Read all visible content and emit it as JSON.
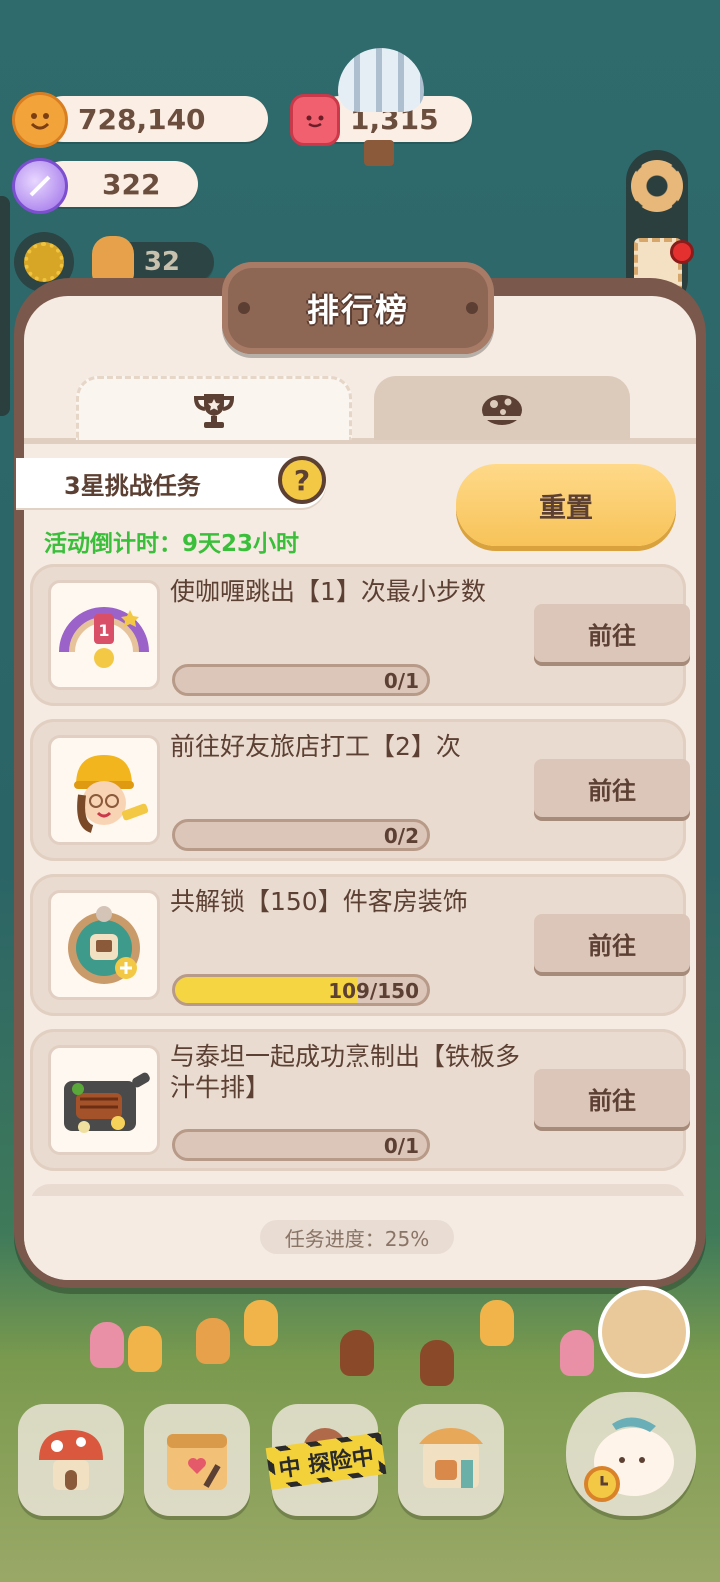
{
  "hud": {
    "coins": "728,140",
    "gems": "1,315",
    "candy": "322",
    "helpers": "32"
  },
  "panel": {
    "title": "排行榜",
    "tabs": [
      {
        "icon": "trophy-icon"
      },
      {
        "icon": "cookie-ball-icon"
      }
    ],
    "challenge_label": "3星挑战任务",
    "help_symbol": "?",
    "countdown": "活动倒计时：9天23小时",
    "reset_label": "重置",
    "go_label": "前往",
    "tasks": [
      {
        "title": "使咖喱跳出【1】次最小步数",
        "progress_text": "0/1",
        "progress": 0.0
      },
      {
        "title": "前往好友旅店打工【2】次",
        "progress_text": "0/2",
        "progress": 0.0
      },
      {
        "title": "共解锁【150】件客房装饰",
        "progress_text": "109/150",
        "progress": 0.727
      },
      {
        "title": "与泰坦一起成功烹制出【铁板多汁牛排】",
        "progress_text": "0/1",
        "progress": 0.0
      }
    ],
    "task_progress": "任务进度：25%"
  },
  "bottom_nav": {
    "explore_label": "中 探险中"
  },
  "colors": {
    "panel_border": "#7a584c",
    "panel_bg": "#f5ebe2",
    "accent_yellow": "#f7c359",
    "countdown_green": "#3bbf3b",
    "progress_fill": "#f6d542"
  }
}
